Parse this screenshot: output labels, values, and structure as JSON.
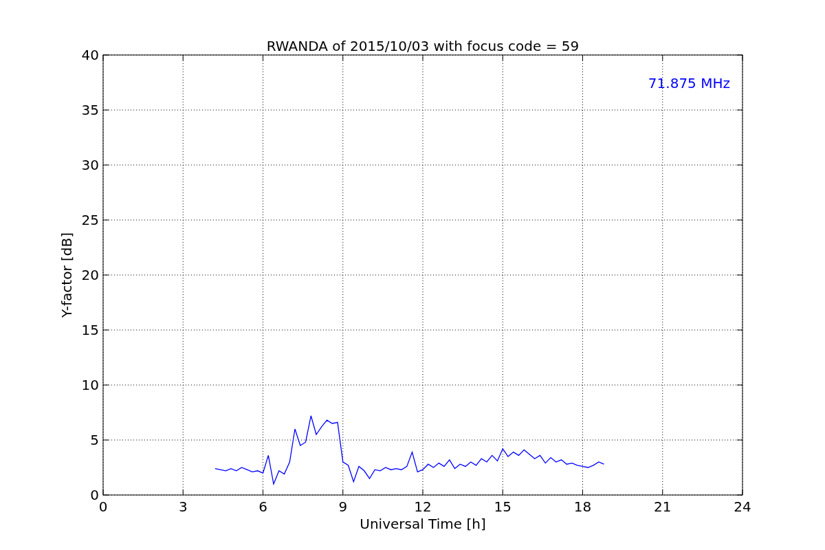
{
  "chart_data": {
    "type": "line",
    "title": "RWANDA of 2015/10/03 with focus code = 59",
    "xlabel": "Universal Time [h]",
    "ylabel": "Y-factor [dB]",
    "x": [
      4.2,
      4.4,
      4.6,
      4.8,
      5.0,
      5.2,
      5.4,
      5.6,
      5.8,
      6.0,
      6.2,
      6.4,
      6.6,
      6.8,
      7.0,
      7.2,
      7.4,
      7.6,
      7.8,
      8.0,
      8.2,
      8.4,
      8.6,
      8.8,
      9.0,
      9.2,
      9.4,
      9.6,
      9.8,
      10.0,
      10.2,
      10.4,
      10.6,
      10.8,
      11.0,
      11.2,
      11.4,
      11.6,
      11.8,
      12.0,
      12.2,
      12.4,
      12.6,
      12.8,
      13.0,
      13.2,
      13.4,
      13.6,
      13.8,
      14.0,
      14.2,
      14.4,
      14.6,
      14.8,
      15.0,
      15.2,
      15.4,
      15.6,
      15.8,
      16.0,
      16.2,
      16.4,
      16.6,
      16.8,
      17.0,
      17.2,
      17.4,
      17.6,
      17.8,
      18.0,
      18.2,
      18.4,
      18.6,
      18.8
    ],
    "series": [
      {
        "name": "71.875 MHz",
        "color": "#0000ff",
        "values": [
          2.4,
          2.3,
          2.2,
          2.4,
          2.2,
          2.5,
          2.3,
          2.1,
          2.2,
          2.0,
          3.6,
          1.0,
          2.2,
          1.9,
          3.0,
          6.0,
          4.5,
          4.8,
          7.2,
          5.5,
          6.2,
          6.8,
          6.5,
          6.6,
          3.0,
          2.7,
          1.2,
          2.6,
          2.2,
          1.5,
          2.3,
          2.2,
          2.5,
          2.3,
          2.4,
          2.3,
          2.6,
          3.9,
          2.1,
          2.3,
          2.8,
          2.5,
          2.9,
          2.6,
          3.2,
          2.4,
          2.8,
          2.6,
          3.0,
          2.7,
          3.3,
          3.0,
          3.6,
          3.1,
          4.2,
          3.5,
          3.9,
          3.6,
          4.1,
          3.7,
          3.3,
          3.6,
          2.9,
          3.4,
          3.0,
          3.2,
          2.8,
          2.9,
          2.7,
          2.6,
          2.5,
          2.7,
          3.0,
          2.8
        ]
      }
    ],
    "xlim": [
      0,
      24
    ],
    "ylim": [
      0,
      40
    ],
    "xticks": [
      0,
      3,
      6,
      9,
      12,
      15,
      18,
      21,
      24
    ],
    "yticks": [
      0,
      5,
      10,
      15,
      20,
      25,
      30,
      35,
      40
    ],
    "grid": true
  }
}
